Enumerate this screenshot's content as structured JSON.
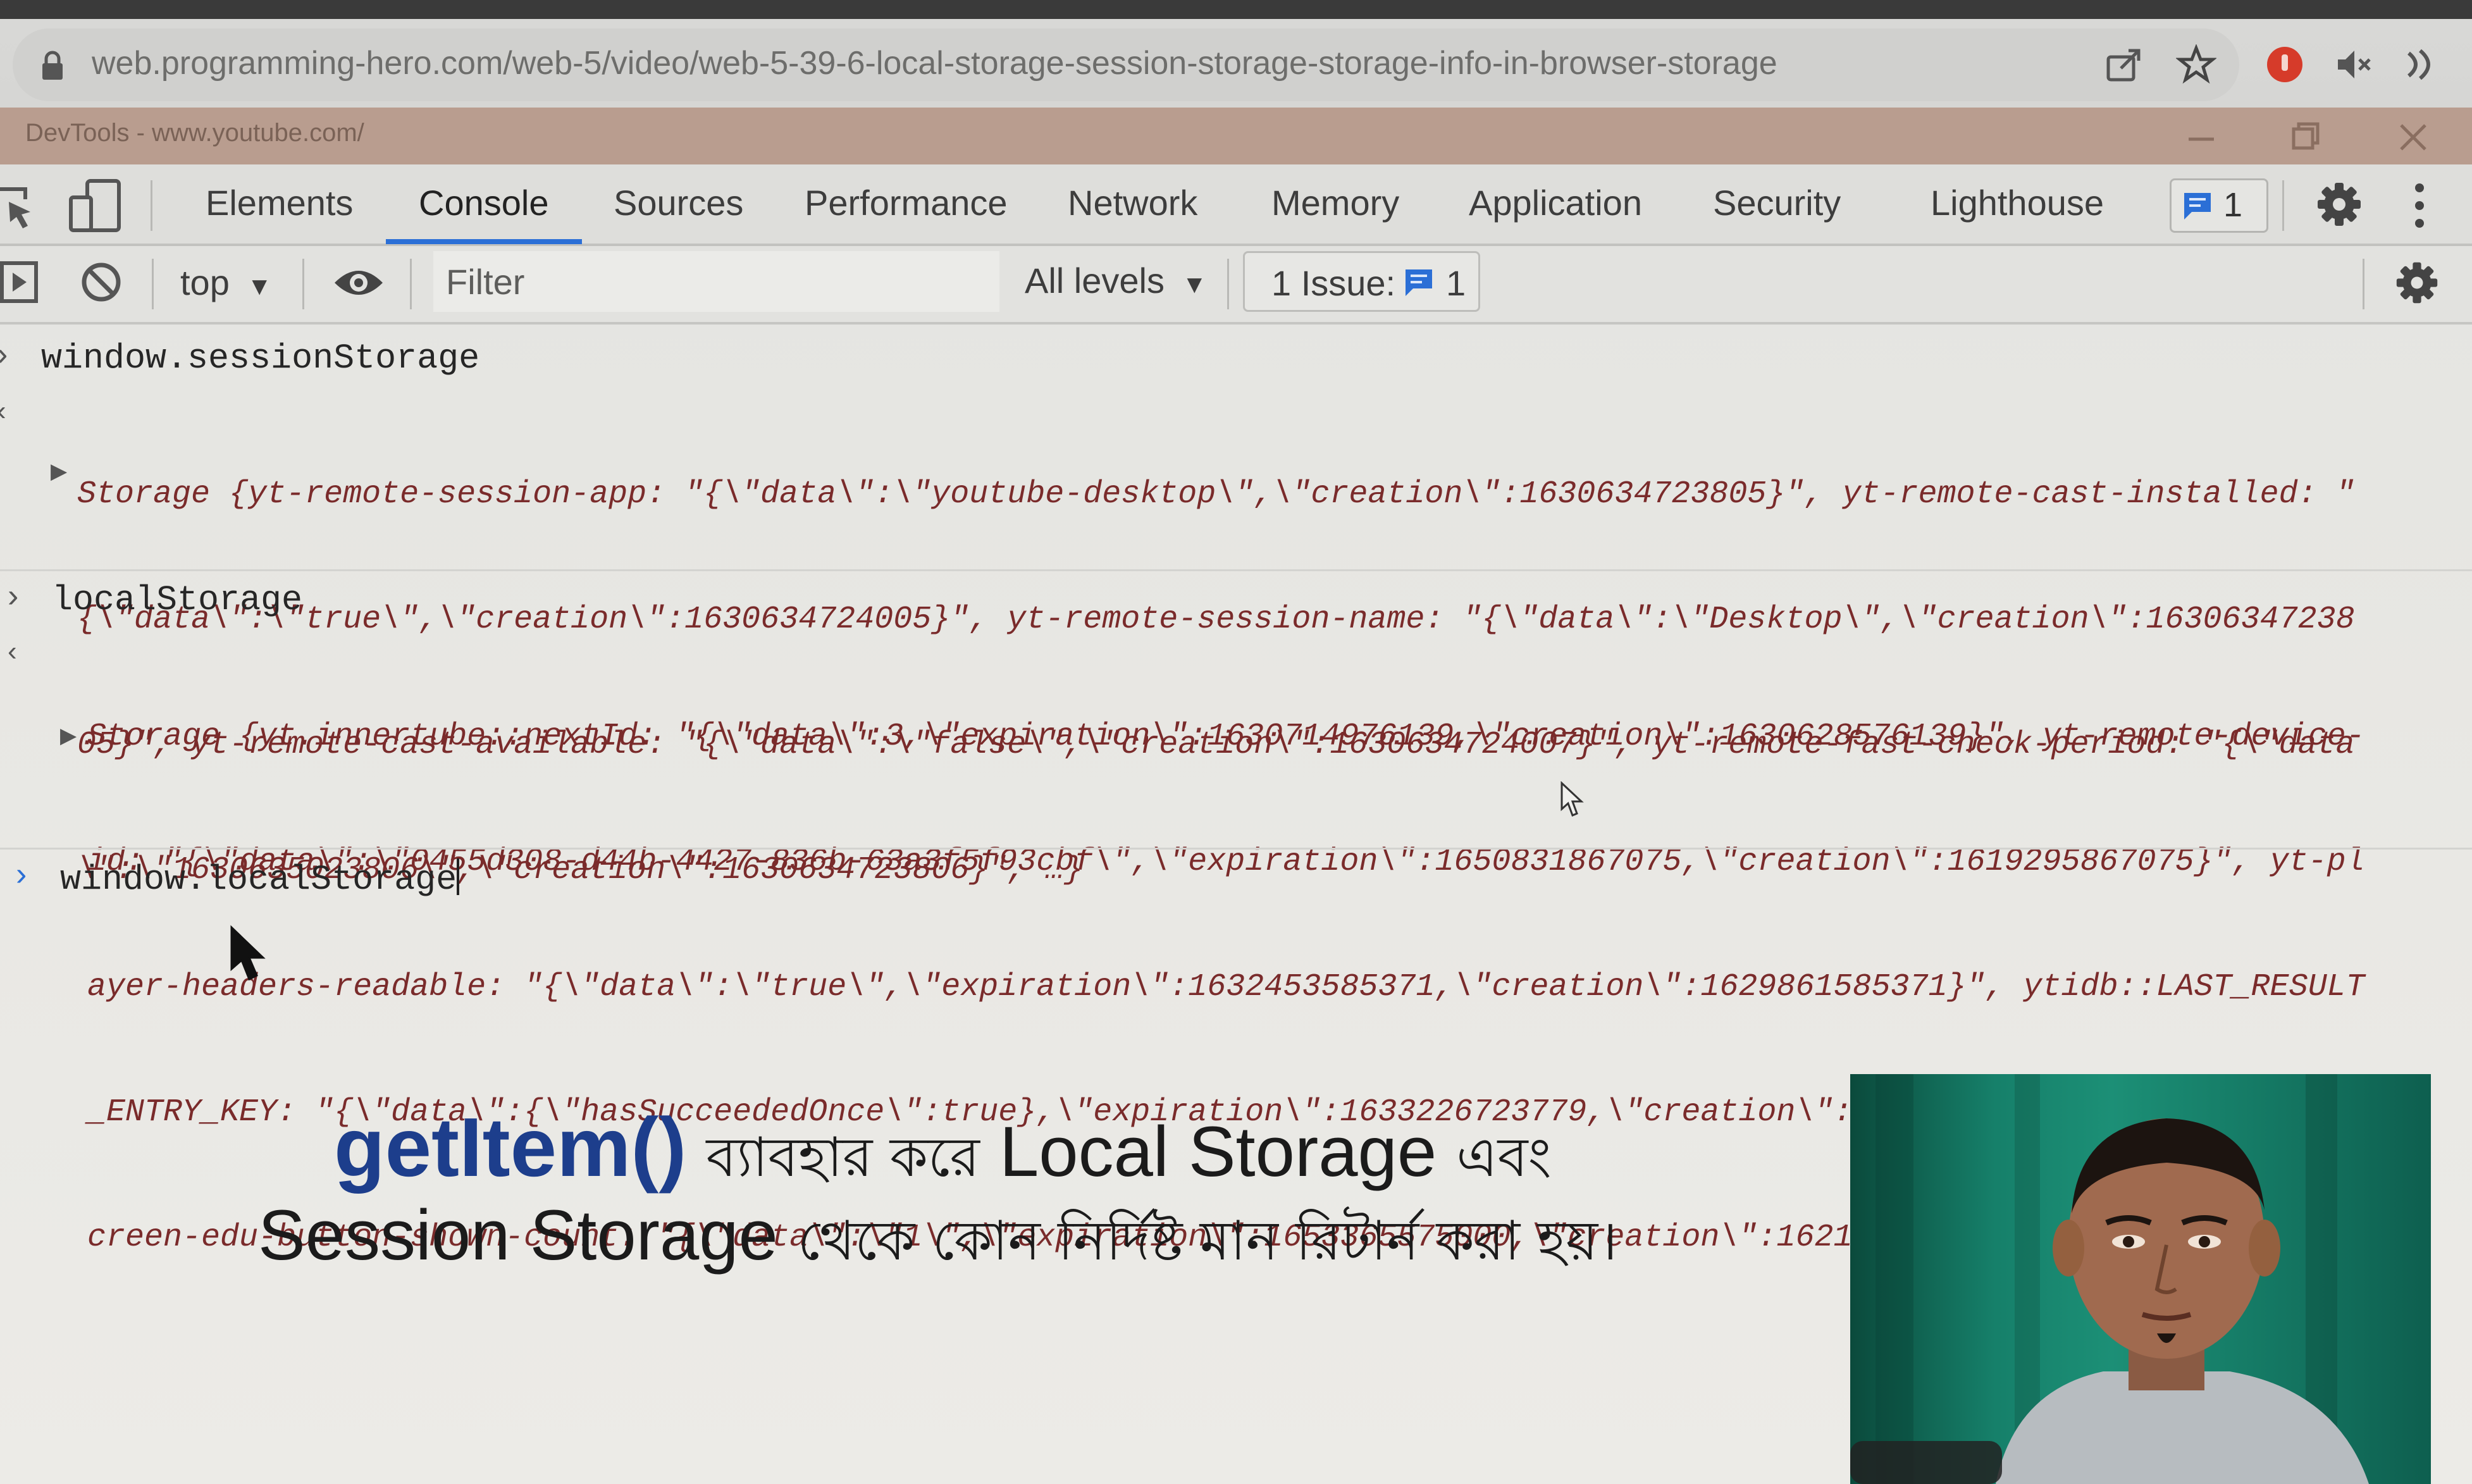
{
  "browser": {
    "url": "web.programming-hero.com/web-5/video/web-5-39-6-local-storage-session-storage-storage-info-in-browser-storage"
  },
  "devtools": {
    "window_title": "DevTools - www.youtube.com/",
    "tabs": [
      {
        "label": "Elements"
      },
      {
        "label": "Console",
        "active": true
      },
      {
        "label": "Sources"
      },
      {
        "label": "Performance"
      },
      {
        "label": "Network"
      },
      {
        "label": "Memory"
      },
      {
        "label": "Application"
      },
      {
        "label": "Security"
      },
      {
        "label": "Lighthouse"
      }
    ],
    "issues_badge": "1",
    "accent_color": "#2b6fd6"
  },
  "console_toolbar": {
    "context": "top",
    "filter_placeholder": "Filter",
    "levels": "All levels",
    "issue_label": "1 Issue:",
    "issue_count": "1"
  },
  "console": {
    "entries": [
      {
        "command": "window.sessionStorage",
        "result_lines": [
          "Storage {yt-remote-session-app: \"{\\\"data\\\":\\\"youtube-desktop\\\",\\\"creation\\\":1630634723805}\", yt-remote-cast-installed: \"",
          "{\\\"data\\\":\\\"true\\\",\\\"creation\\\":1630634724005}\", yt-remote-session-name: \"{\\\"data\\\":\\\"Desktop\\\",\\\"creation\\\":16306347238",
          "05}\", yt-remote-cast-available: \"{\\\"data\\\":\\\"false\\\",\\\"creation\\\":1630634724007}\", yt-remote-fast-check-period: \"{\\\"data",
          "\\\":\\\"1630635023806\\\",\\\"creation\\\":1630634723806}\", …}"
        ]
      },
      {
        "command": "localStorage",
        "result_lines": [
          "Storage {yt.innertube::nextId: \"{\\\"data\\\":3,\\\"expiration\\\":1630714976139,\\\"creation\\\":1630628576139}\", yt-remote-device-",
          "id: \"{\\\"data\\\":\\\"0455d308-d44b-4427-836b-63a3f5f93cbf\\\",\\\"expiration\\\":1650831867075,\\\"creation\\\":1619295867075}\", yt-pl",
          "ayer-headers-readable: \"{\\\"data\\\":\\\"true\\\",\\\"expiration\\\":1632453585371,\\\"creation\\\":1629861585371}\", ytidb::LAST_RESULT",
          "_ENTRY_KEY: \"{\\\"data\\\":{\\\"hasSucceededOnce\\\":true},\\\"expiration\\\":1633226723779,\\\"creation\\\":1630634723779}\", yt-fullers",
          "creen-edu-button-shown-count: \"{\\\"data\\\":\\\"1\\\",\\\"expiration\\\":1653365575000,\\\"creation\\\":1621829575000}\", …}"
        ]
      }
    ],
    "current_input": "window.localStorage"
  },
  "caption": {
    "highlight": "getItem()",
    "line1_bn_1": "ব্যাবহার করে",
    "line1_en": "Local Storage",
    "line1_bn_2": "এবং",
    "line2_en": "Session Storage",
    "line2_bn": "থেকে কোন নির্দিষ্ট মান রিটার্ন করা হয়।"
  }
}
